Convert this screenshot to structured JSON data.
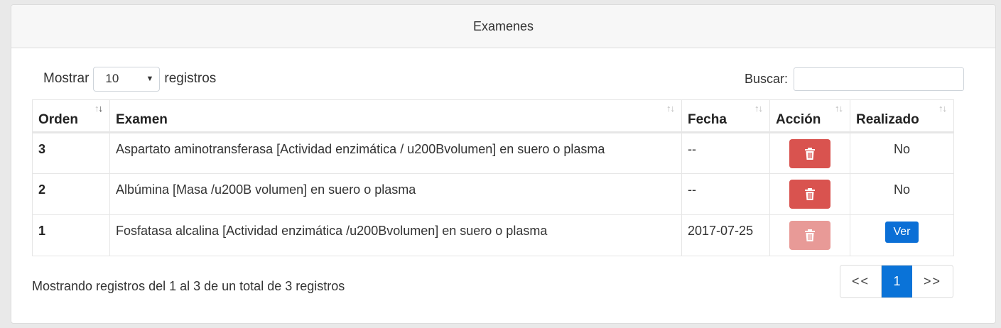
{
  "card": {
    "title": "Examenes"
  },
  "length": {
    "prefix": "Mostrar",
    "value": "10",
    "suffix": "registros"
  },
  "search": {
    "label": "Buscar:",
    "value": ""
  },
  "table": {
    "headers": [
      "Orden",
      "Examen",
      "Fecha",
      "Acción",
      "Realizado"
    ],
    "rows": [
      {
        "orden": "3",
        "examen": "Aspartato aminotransferasa [Actividad enzimática / u200Bvolumen] en suero o plasma",
        "fecha": "--",
        "delete_enabled": true,
        "realizado": "No"
      },
      {
        "orden": "2",
        "examen": "Albúmina [Masa /u200B volumen] en suero o plasma",
        "fecha": "--",
        "delete_enabled": true,
        "realizado": "No"
      },
      {
        "orden": "1",
        "examen": "Fosfatasa alcalina [Actividad enzimática /u200Bvolumen] en suero o plasma",
        "fecha": "2017-07-25",
        "delete_enabled": false,
        "realizado_button": "Ver"
      }
    ]
  },
  "info": "Mostrando registros del 1 al 3 de un total de 3 registros",
  "pager": {
    "prev": "<<",
    "current": "1",
    "next": ">>"
  },
  "colors": {
    "danger": "#d9534f",
    "danger_disabled": "#e89a97",
    "primary": "#0b6fd6"
  },
  "icons": {
    "delete": "trash-icon",
    "sort": "sort-arrows-icon"
  }
}
